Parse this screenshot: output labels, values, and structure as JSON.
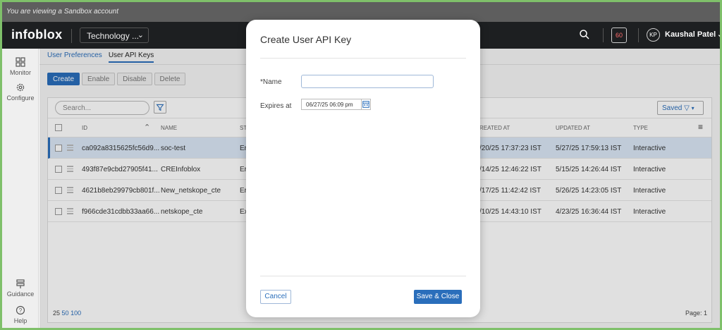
{
  "banner": {
    "text": "You are viewing a Sandbox account"
  },
  "topbar": {
    "logo": "infoblox",
    "tenant": "Technology ...",
    "notifications": "60",
    "avatar_initials": "KP",
    "user_name": "Kaushal Patel"
  },
  "nav": {
    "monitor": "Monitor",
    "configure": "Configure",
    "guidance": "Guidance",
    "help": "Help"
  },
  "tabs": [
    "User Preferences",
    "User API Keys"
  ],
  "actions": {
    "create": "Create",
    "enable": "Enable",
    "disable": "Disable",
    "delete": "Delete"
  },
  "grid": {
    "search_placeholder": "Search...",
    "saved_label": "Saved",
    "columns": {
      "id": "ID",
      "name": "NAME",
      "created": "REATED AT",
      "updated": "UPDATED AT",
      "type": "TYPE",
      "state": "ST"
    },
    "rows": [
      {
        "id": "ca092a8315625fc56d9...",
        "name": "soc-test",
        "state": "Er",
        "created": "/20/25 17:37:23 IST",
        "updated": "5/27/25 17:59:13 IST",
        "type": "Interactive"
      },
      {
        "id": "493f87e9cbd27905f41...",
        "name": "CREInfoblox",
        "state": "Er",
        "created": "/14/25 12:46:22 IST",
        "updated": "5/15/25 14:26:44 IST",
        "type": "Interactive"
      },
      {
        "id": "4621b8eb29979cb801f...",
        "name": "New_netskope_cte",
        "state": "Er",
        "created": "/17/25 11:42:42 IST",
        "updated": "5/26/25 14:23:05 IST",
        "type": "Interactive"
      },
      {
        "id": "f966cde31cdbb33aa66...",
        "name": "netskope_cte",
        "state": "Ex",
        "created": "/10/25 14:43:10 IST",
        "updated": "4/23/25 16:36:44 IST",
        "type": "Interactive"
      }
    ],
    "page_sizes": [
      "25",
      "50",
      "100"
    ],
    "page_label": "Page: 1"
  },
  "modal": {
    "title": "Create User API Key",
    "name_label": "*Name",
    "name_value": "",
    "expires_label": "Expires at",
    "expires_value": "06/27/25 06:09 pm",
    "cancel": "Cancel",
    "save": "Save & Close"
  },
  "colors": {
    "accent": "#2a6ebb",
    "frame": "#7fc06a",
    "topbar": "#1d1f21",
    "selected_row": "#dbe8f6"
  }
}
